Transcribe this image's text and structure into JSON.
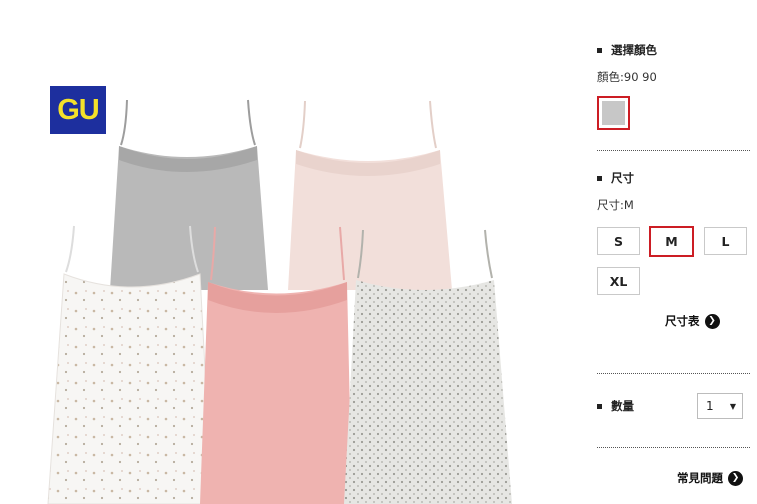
{
  "brand": {
    "logo_text": "GU",
    "logo_bg": "#1d2f9e",
    "logo_fg": "#f4e12a"
  },
  "color_section": {
    "title": "選擇顏色",
    "selected_label": "顏色:90 90",
    "swatches": [
      {
        "color": "#c7c7c7",
        "selected": true
      }
    ]
  },
  "size_section": {
    "title": "尺寸",
    "selected_label": "尺寸:M",
    "options": [
      "S",
      "M",
      "L",
      "XL"
    ],
    "selected": "M",
    "size_chart_link": "尺寸表"
  },
  "quantity": {
    "label": "數量",
    "value": "1",
    "caret_icon": "caret-down-icon"
  },
  "faq_link": "常見問題",
  "accent_color": "#cc1d24"
}
